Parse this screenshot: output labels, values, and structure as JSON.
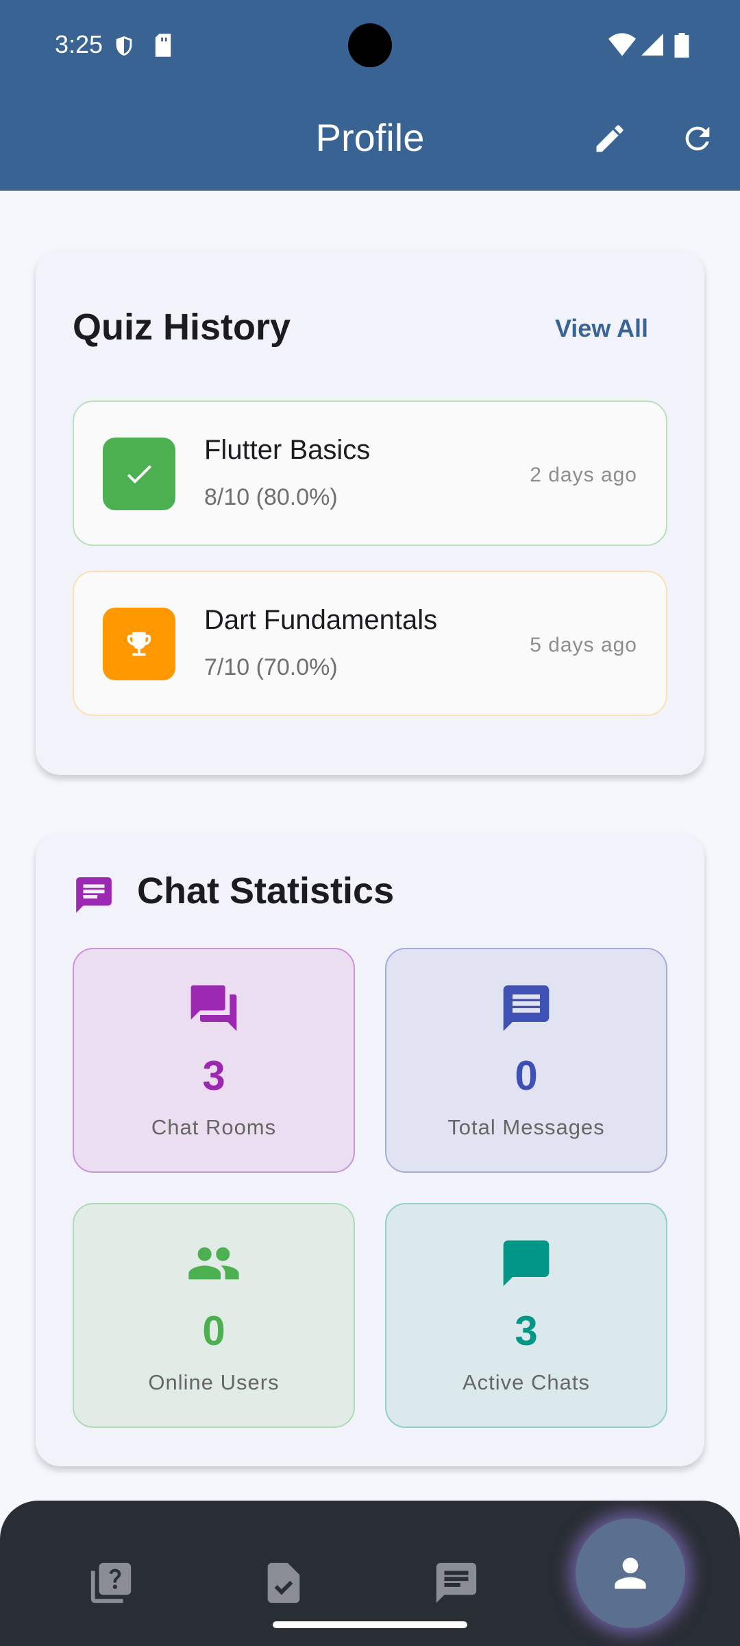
{
  "status_bar": {
    "time": "3:25"
  },
  "app_bar": {
    "title": "Profile"
  },
  "quiz_history": {
    "title": "Quiz History",
    "view_all": "View All",
    "items": [
      {
        "name": "Flutter Basics",
        "score": "8/10 (80.0%)",
        "when": "2 days ago",
        "status": "passed",
        "color": "#4caf50"
      },
      {
        "name": "Dart Fundamentals",
        "score": "7/10 (70.0%)",
        "when": "5 days ago",
        "status": "trophy",
        "color": "#ff9800"
      }
    ]
  },
  "chat_statistics": {
    "title": "Chat Statistics",
    "stats": [
      {
        "value": "3",
        "label": "Chat Rooms",
        "color": "#9c27b0",
        "icon": "forum-icon"
      },
      {
        "value": "0",
        "label": "Total Messages",
        "color": "#3f51b5",
        "icon": "message-icon"
      },
      {
        "value": "0",
        "label": "Online Users",
        "color": "#4caf50",
        "icon": "people-icon"
      },
      {
        "value": "3",
        "label": "Active Chats",
        "color": "#009688",
        "icon": "chat-bubble-icon"
      }
    ]
  },
  "bottom_nav": {
    "items": [
      "quiz-icon",
      "assignment-check-icon",
      "chat-icon",
      "profile-icon"
    ],
    "active_index": 3
  }
}
